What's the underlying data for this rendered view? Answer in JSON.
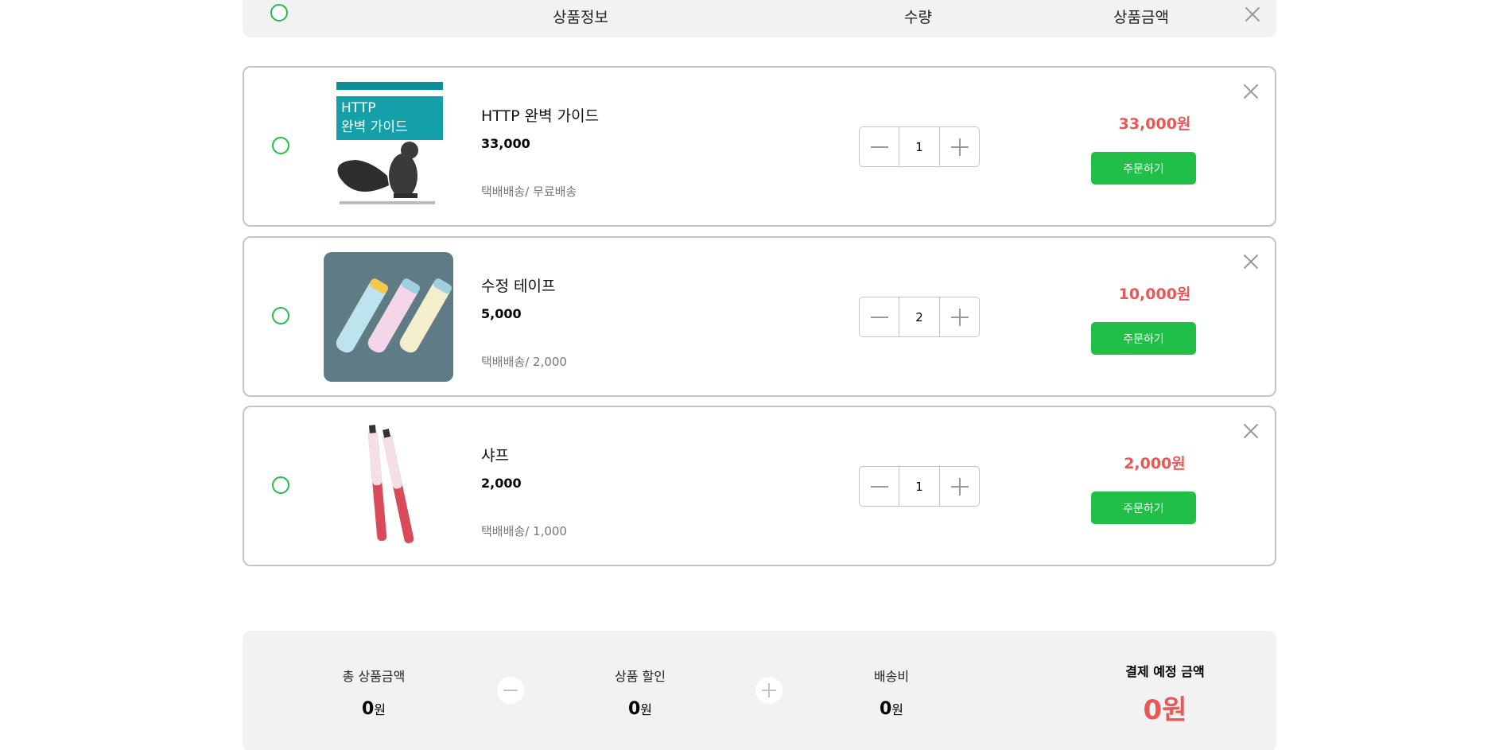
{
  "header": {
    "col_info": "상품정보",
    "col_qty": "수량",
    "col_price": "상품금액"
  },
  "items": [
    {
      "name": "HTTP 완벽 가이드",
      "unit_price": "33,000",
      "delivery": "택배배송/ 무료배송",
      "quantity": "1",
      "line_price": "33,000원",
      "order_label": "주문하기",
      "cover_title_1": "HTTP",
      "cover_title_2": "완벽 가이드"
    },
    {
      "name": "수정 테이프",
      "unit_price": "5,000",
      "delivery": "택배배송/ 2,000",
      "quantity": "2",
      "line_price": "10,000원",
      "order_label": "주문하기"
    },
    {
      "name": "샤프",
      "unit_price": "2,000",
      "delivery": "택배배송/ 1,000",
      "quantity": "1",
      "line_price": "2,000원",
      "order_label": "주문하기"
    }
  ],
  "summary": {
    "total_label": "총 상품금액",
    "total_value": "0",
    "discount_label": "상품 할인",
    "discount_value": "0",
    "shipping_label": "배송비",
    "shipping_value": "0",
    "won": "원",
    "final_label": "결제 예정 금액",
    "final_value": "0원"
  },
  "colors": {
    "accent_green": "#21bf48",
    "price_red": "#eb5757",
    "panel_gray": "#f2f2f2"
  }
}
